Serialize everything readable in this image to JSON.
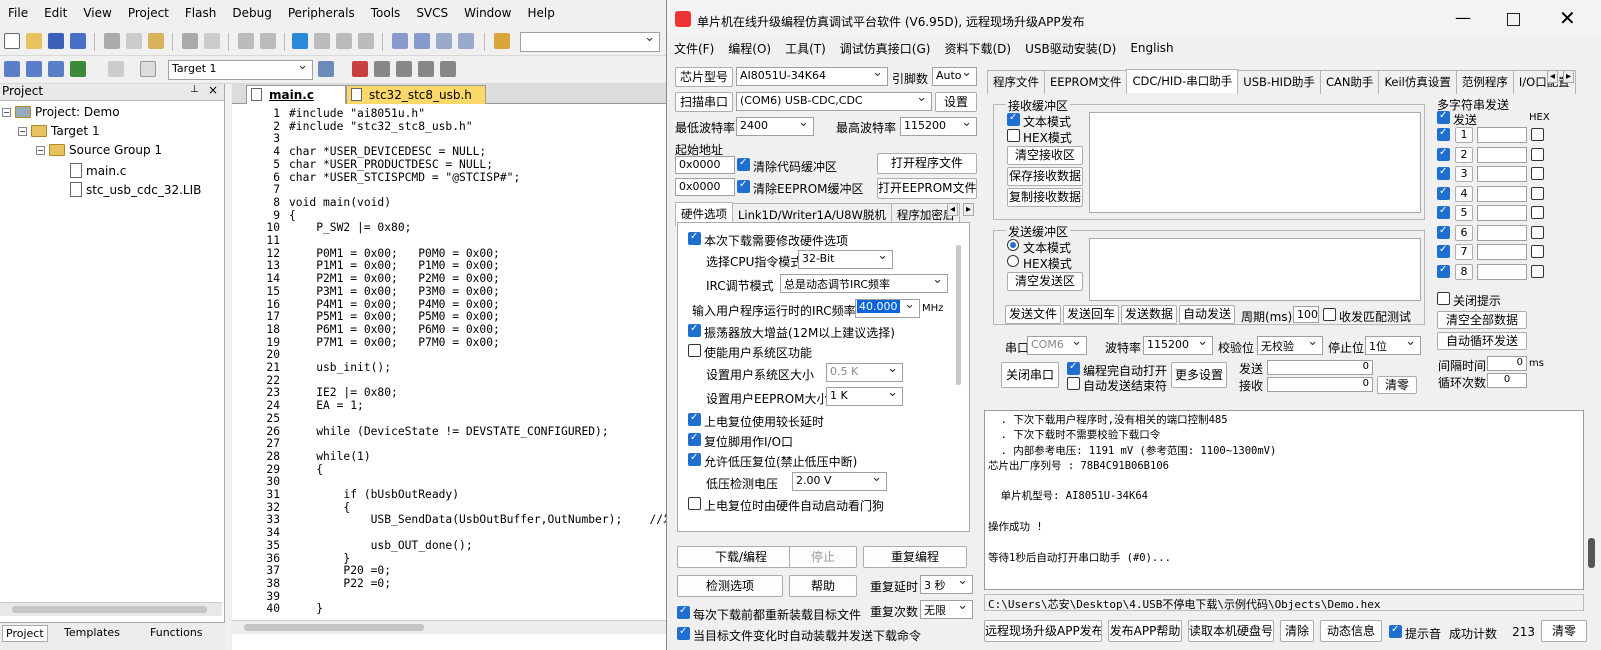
{
  "ide": {
    "menu": [
      "File",
      "Edit",
      "View",
      "Project",
      "Flash",
      "Debug",
      "Peripherals",
      "Tools",
      "SVCS",
      "Window",
      "Help"
    ],
    "target_combo": "Target 1",
    "project_panel_title": "Project",
    "tree": {
      "project": "Project: Demo",
      "target": "Target 1",
      "group": "Source Group 1",
      "files": [
        "main.c",
        "stc_usb_cdc_32.LIB"
      ]
    },
    "bottom_tabs": [
      "Project",
      "Templates",
      "Functions"
    ],
    "file_tabs": [
      "main.c",
      "stc32_stc8_usb.h"
    ],
    "code_lines": [
      {
        "n": "1",
        "t": "#include \"ai8051u.h\""
      },
      {
        "n": "2",
        "t": "#include \"stc32_stc8_usb.h\""
      },
      {
        "n": "3",
        "t": ""
      },
      {
        "n": "4",
        "t": "char *USER_DEVICEDESC = NULL;"
      },
      {
        "n": "5",
        "t": "char *USER_PRODUCTDESC = NULL;"
      },
      {
        "n": "6",
        "t": "char *USER_STCISPCMD = \"@STCISP#\";"
      },
      {
        "n": "7",
        "t": ""
      },
      {
        "n": "8",
        "t": "void main(void)"
      },
      {
        "n": "9",
        "t": "{"
      },
      {
        "n": "10",
        "t": "    P_SW2 |= 0x80;"
      },
      {
        "n": "11",
        "t": ""
      },
      {
        "n": "12",
        "t": "    P0M1 = 0x00;   P0M0 = 0x00;"
      },
      {
        "n": "13",
        "t": "    P1M1 = 0x00;   P1M0 = 0x00;"
      },
      {
        "n": "14",
        "t": "    P2M1 = 0x00;   P2M0 = 0x00;"
      },
      {
        "n": "15",
        "t": "    P3M1 = 0x00;   P3M0 = 0x00;"
      },
      {
        "n": "16",
        "t": "    P4M1 = 0x00;   P4M0 = 0x00;"
      },
      {
        "n": "17",
        "t": "    P5M1 = 0x00;   P5M0 = 0x00;"
      },
      {
        "n": "18",
        "t": "    P6M1 = 0x00;   P6M0 = 0x00;"
      },
      {
        "n": "19",
        "t": "    P7M1 = 0x00;   P7M0 = 0x00;"
      },
      {
        "n": "20",
        "t": ""
      },
      {
        "n": "21",
        "t": "    usb_init();"
      },
      {
        "n": "22",
        "t": ""
      },
      {
        "n": "23",
        "t": "    IE2 |= 0x80;"
      },
      {
        "n": "24",
        "t": "    EA = 1;"
      },
      {
        "n": "25",
        "t": ""
      },
      {
        "n": "26",
        "t": "    while (DeviceState != DEVSTATE_CONFIGURED);"
      },
      {
        "n": "27",
        "t": ""
      },
      {
        "n": "28",
        "t": "    while(1)"
      },
      {
        "n": "29",
        "t": "    {"
      },
      {
        "n": "30",
        "t": ""
      },
      {
        "n": "31",
        "t": "        if (bUsbOutReady)"
      },
      {
        "n": "32",
        "t": "        {"
      },
      {
        "n": "33",
        "t": "            USB_SendData(UsbOutBuffer,OutNumber);    //发"
      },
      {
        "n": "34",
        "t": ""
      },
      {
        "n": "35",
        "t": "            usb_OUT_done();"
      },
      {
        "n": "36",
        "t": "        }"
      },
      {
        "n": "37",
        "t": "        P20 =0;"
      },
      {
        "n": "38",
        "t": "        P22 =0;"
      },
      {
        "n": "39",
        "t": ""
      },
      {
        "n": "40",
        "t": "    }"
      }
    ]
  },
  "stc": {
    "title": "单片机在线升级编程仿真调试平台软件 (V6.95D), 远程现场升级APP发布",
    "menu": [
      "文件(F)",
      "编程(O)",
      "工具(T)",
      "调试仿真接口(G)",
      "资料下载(D)",
      "USB驱动安装(D)",
      "English"
    ],
    "chip_btn": "芯片型号",
    "chip_value": "AI8051U-34K64",
    "pins_label": "引脚数",
    "pins_value": "Auto",
    "scan_btn": "扫描串口",
    "port_value": "(COM6) USB-CDC,CDC",
    "settings_btn": "设置",
    "min_baud_label": "最低波特率",
    "min_baud": "2400",
    "max_baud_label": "最高波特率",
    "max_baud": "115200",
    "start_addr_label": "起始地址",
    "addr1": "0x0000",
    "clear_code": "清除代码缓冲区",
    "open_prog": "打开程序文件",
    "addr2": "0x0000",
    "clear_eeprom": "清除EEPROM缓冲区",
    "open_eeprom": "打开EEPROM文件",
    "hw_tabs": [
      "硬件选项",
      "Link1D/Writer1A/U8W脱机",
      "程序加密后"
    ],
    "hw": {
      "modify_hw": "本次下载需要修改硬件选项",
      "cpu_mode_label": "选择CPU指令模式",
      "cpu_mode": "32-Bit",
      "irc_mode_label": "IRC调节模式",
      "irc_mode": "总是动态调节IRC频率",
      "irc_freq_label": "输入用户程序运行时的IRC频率",
      "irc_freq": "40.000",
      "irc_unit": "MHz",
      "osc_gain": "振荡器放大增益(12M以上建议选择)",
      "user_sys": "使能用户系统区功能",
      "sys_size_label": "设置用户系统区大小",
      "sys_size": "0.5 K",
      "eeprom_size_label": "设置用户EEPROM大小",
      "eeprom_size": "1   K",
      "long_delay": "上电复位使用较长延时",
      "reset_io": "复位脚用作I/O口",
      "low_volt_reset": "允许低压复位(禁止低压中断)",
      "low_volt_label": "低压检测电压",
      "low_volt": "2.00 V",
      "watchdog": "上电复位时由硬件自动启动看门狗"
    },
    "download_btn": "下载/编程",
    "stop_btn": "停止",
    "reprog_btn": "重复编程",
    "check_btn": "检测选项",
    "help_btn": "帮助",
    "repeat_delay_label": "重复延时",
    "repeat_delay": "3 秒",
    "repeat_count_label": "重复次数",
    "repeat_count": "无限",
    "reload_before": "每次下载前都重新装载目标文件",
    "auto_send": "当目标文件变化时自动装载并发送下载命令",
    "right_tabs": [
      "程序文件",
      "EEPROM文件",
      "CDC/HID-串口助手",
      "USB-HID助手",
      "CAN助手",
      "Keil仿真设置",
      "范例程序",
      "I/O口配置"
    ],
    "recv": {
      "title": "接收缓冲区",
      "text_mode": "文本模式",
      "hex_mode": "HEX模式",
      "clear": "清空接收区",
      "save": "保存接收数据",
      "copy": "复制接收数据"
    },
    "send": {
      "title": "发送缓冲区",
      "text_mode": "文本模式",
      "hex_mode": "HEX模式",
      "clear": "清空发送区",
      "send_file": "发送文件",
      "send_return": "发送回车",
      "send_data": "发送数据",
      "auto_send": "自动发送",
      "period_label": "周期(ms)",
      "period": "100",
      "match_test": "收发匹配测试"
    },
    "serial": {
      "port_label": "串口",
      "port": "COM6",
      "baud_label": "波特率",
      "baud": "115200",
      "parity_label": "校验位",
      "parity": "无校验",
      "stop_label": "停止位",
      "stop": "1位",
      "close_btn": "关闭串口",
      "auto_open": "编程完自动打开",
      "auto_end": "自动发送结束符",
      "more_btn": "更多设置",
      "tx_label": "发送",
      "tx": "0",
      "rx_label": "接收",
      "rx": "0",
      "clear_btn": "清零"
    },
    "multi": {
      "title": "多字符串发送",
      "send_label": "发送",
      "hex_label": "HEX",
      "rows": [
        "1",
        "2",
        "3",
        "4",
        "5",
        "6",
        "7",
        "8"
      ],
      "close_tip": "关闭提示",
      "clear_all": "清空全部数据",
      "auto_loop": "自动循环发送",
      "interval_label": "间隔时间",
      "interval": "0",
      "interval_unit": "ms",
      "loop_label": "循环次数",
      "loop": "0"
    },
    "log": [
      "  . 下次下载用户程序时,没有相关的端口控制485",
      "  . 下次下载时不需要校验下载口令",
      "  . 内部参考电压: 1191 mV (参考范围: 1100~1300mV)",
      "芯片出厂序列号 : 78B4C91B06B106",
      "",
      "  单片机型号: AI8051U-34K64",
      "",
      "操作成功 !",
      "",
      "等待1秒后自动打开串口助手 (#0)..."
    ],
    "path": "C:\\Users\\芯安\\Desktop\\4.USB不停电下载\\示例代码\\Objects\\Demo.hex",
    "bottom_btns": [
      "远程现场升级APP发布",
      "发布APP帮助",
      "读取本机硬盘号",
      "清除",
      "动态信息"
    ],
    "beep": "提示音",
    "success_label": "成功计数",
    "success_count": "213",
    "clear_count": "清零"
  }
}
